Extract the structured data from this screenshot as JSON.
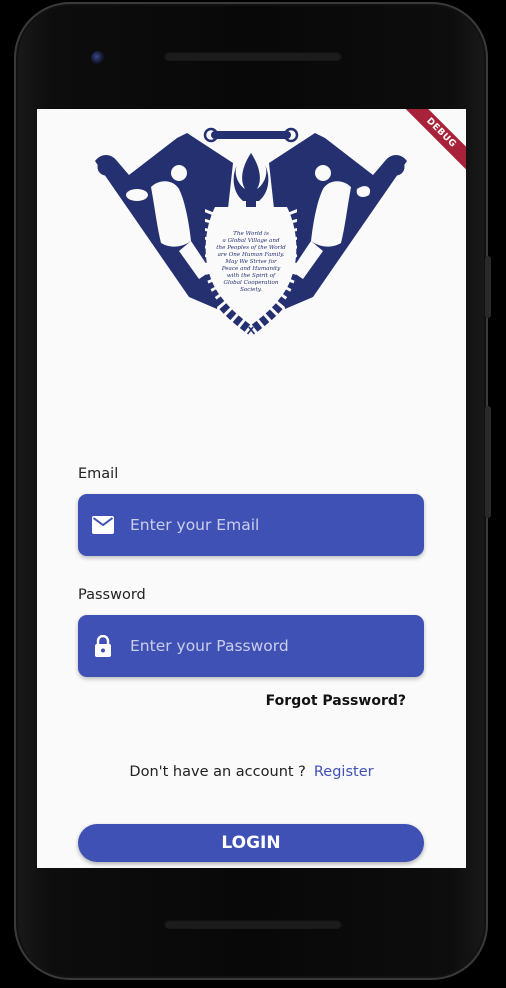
{
  "app": {
    "debug_banner": "DEBUG"
  },
  "emblem": {
    "icon": "global-cooperation-emblem",
    "color": "#24306f",
    "motto_lines": [
      "The World is",
      "a Global Village and",
      "the Peoples of the World",
      "are One Human Family.",
      "May We Strive for",
      "Peace and Humanity",
      "with the Spirit of",
      "Global Cooperation",
      "Society."
    ]
  },
  "form": {
    "email": {
      "label": "Email",
      "placeholder": "Enter your Email",
      "value": "",
      "icon": "mail-icon"
    },
    "password": {
      "label": "Password",
      "placeholder": "Enter your Password",
      "value": "",
      "icon": "lock-icon"
    },
    "forgot_password": "Forgot Password?",
    "no_account_text": "Don't have an account ?",
    "register_link": "Register",
    "login_button": "LOGIN"
  },
  "colors": {
    "primary": "#3f51b5",
    "screen_bg": "#fafafa",
    "debug_ribbon": "#a8233a"
  }
}
